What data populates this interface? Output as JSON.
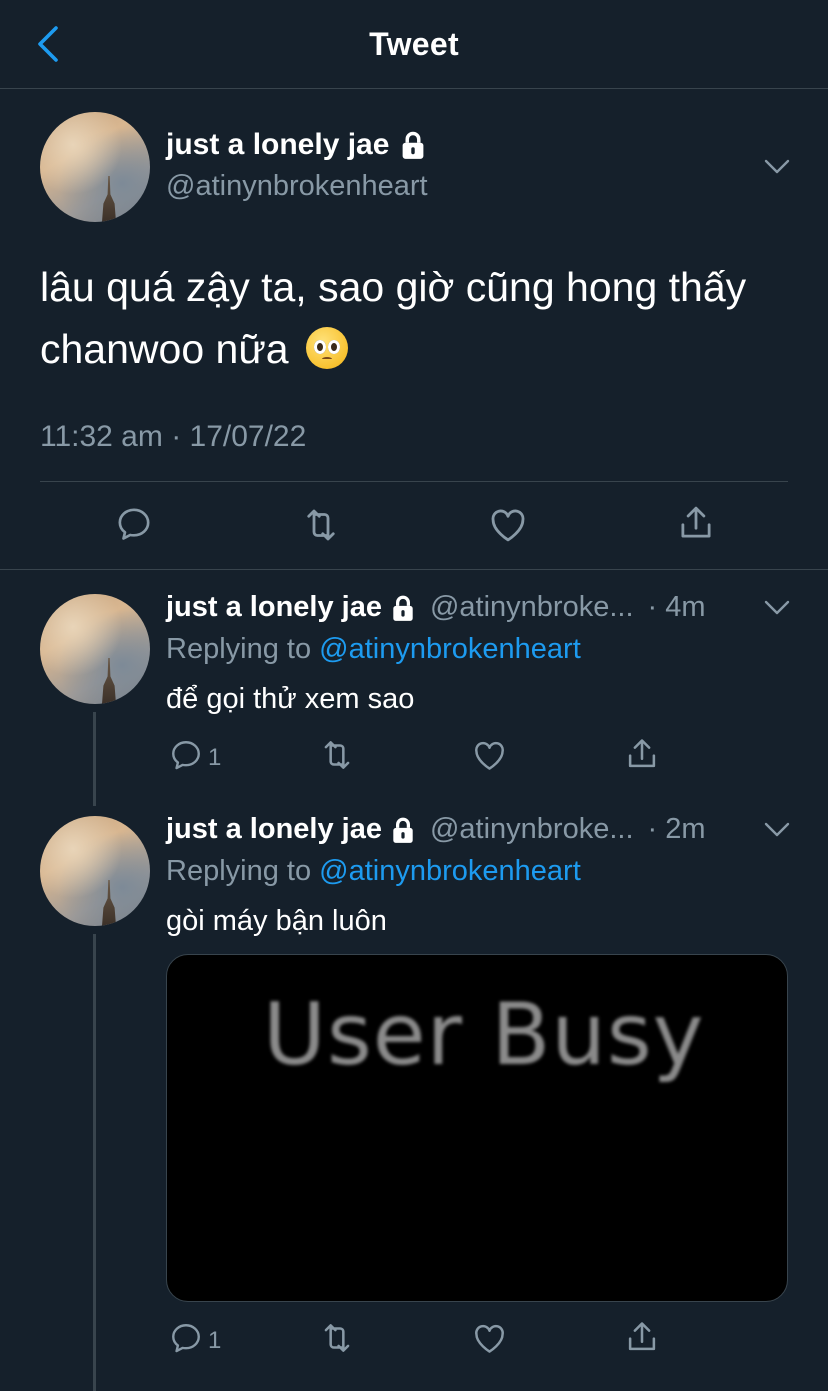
{
  "header": {
    "title": "Tweet"
  },
  "main_tweet": {
    "name": "just a lonely jae",
    "handle": "@atinynbrokenheart",
    "text": "lâu quá zậy ta, sao giờ cũng hong thấy chanwoo nữa",
    "emoji": "pleading-face",
    "timestamp": "11:32 am · 17/07/22"
  },
  "replies": [
    {
      "name": "just a lonely jae",
      "handle": "@atinynbroke...",
      "time": "· 4m",
      "replying_prefix": "Replying to",
      "replying_mention": "@atinynbrokenheart",
      "text": "để gọi thử xem sao",
      "reply_count": "1"
    },
    {
      "name": "just a lonely jae",
      "handle": "@atinynbroke...",
      "time": "· 2m",
      "replying_prefix": "Replying to",
      "replying_mention": "@atinynbrokenheart",
      "text": "gòi máy bận luôn",
      "media_text": "User Busy",
      "reply_count": "1"
    }
  ],
  "colors": {
    "background": "#15202b",
    "accent": "#1d9bf0",
    "secondary_text": "#8899a6",
    "divider": "#38444d"
  },
  "icons": [
    "back-arrow-icon",
    "lock-icon",
    "chevron-down-icon",
    "reply-icon",
    "retweet-icon",
    "like-icon",
    "share-icon"
  ]
}
